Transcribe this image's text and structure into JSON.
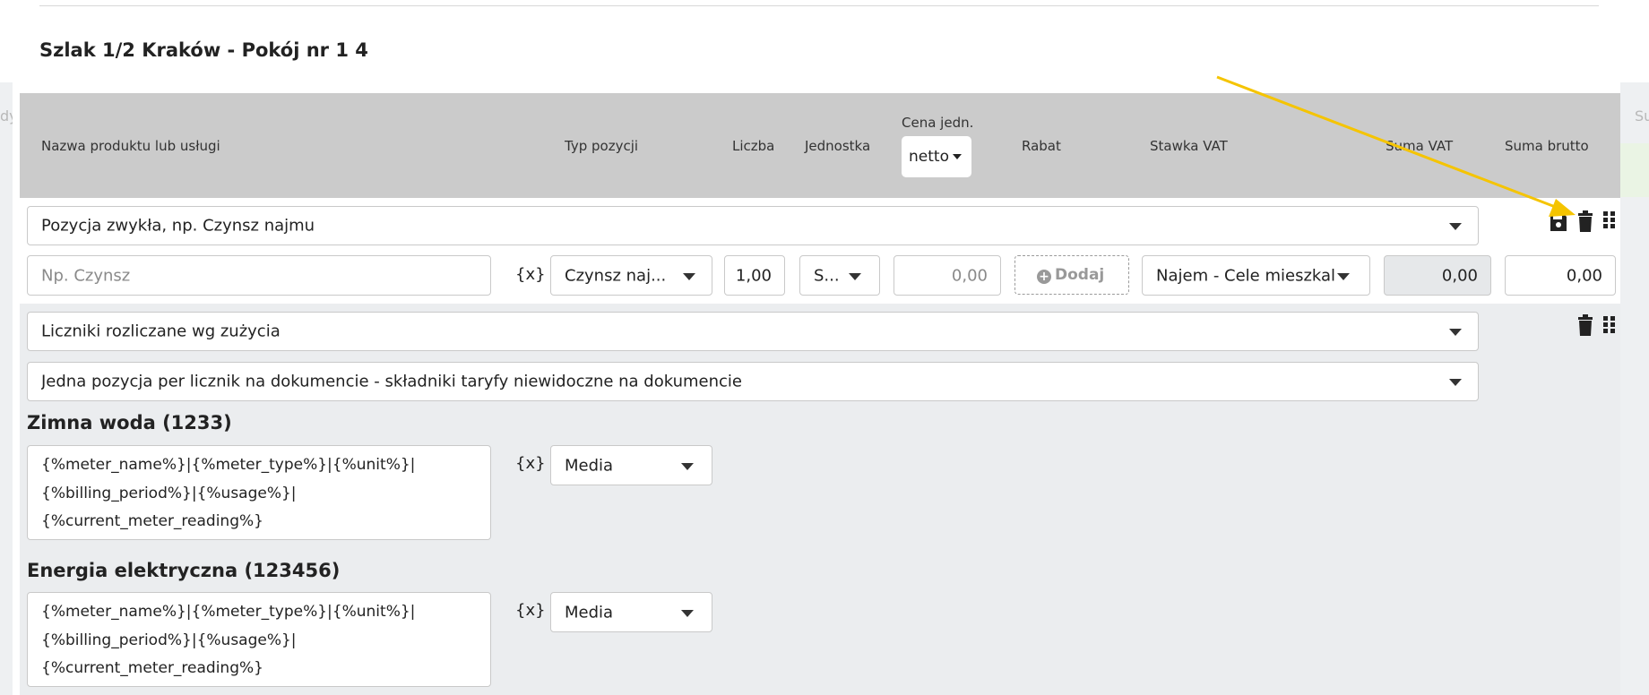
{
  "background": {
    "left_fragment": "dy",
    "right_fragment": "Su"
  },
  "title": "Szlak 1/2 Kraków - Pokój nr 1 4",
  "columns": {
    "name": "Nazwa produktu lub usługi",
    "type": "Typ pozycji",
    "qty": "Liczba",
    "unit": "Jednostka",
    "price": "Cena jedn.",
    "price_mode": "netto",
    "discount": "Rabat",
    "vat_rate": "Stawka VAT",
    "vat_sum": "Suma VAT",
    "gross_sum": "Suma brutto"
  },
  "row1": {
    "kind_select": "Pozycja zwykła, np. Czynsz najmu",
    "name_placeholder": "Np. Czynsz",
    "var_button": "{x}",
    "type_select": "Czynsz naj...",
    "qty": "1,00",
    "unit_select": "S...",
    "price_placeholder": "0,00",
    "discount_button": "Dodaj",
    "vat_select": "Najem - Cele mieszkal",
    "vat_sum": "0,00",
    "gross_sum": "0,00"
  },
  "row2": {
    "kind_select": "Liczniki rozliczane wg zużycia",
    "mode_select": "Jedna pozycja per licznik na dokumencie - składniki taryfy niewidoczne na dokumencie",
    "meters": [
      {
        "title": "Zimna woda (1233)",
        "template_lines": [
          "{%meter_name%}|{%meter_type%}|{%unit%}|",
          "{%billing_period%}|{%usage%}|",
          "{%current_meter_reading%}"
        ],
        "var_button": "{x}",
        "type_select": "Media"
      },
      {
        "title": "Energia elektryczna (123456)",
        "template_lines": [
          "{%meter_name%}|{%meter_type%}|{%unit%}|",
          "{%billing_period%}|{%usage%}|",
          "{%current_meter_reading%}"
        ],
        "var_button": "{x}",
        "type_select": "Media"
      }
    ]
  },
  "icons": [
    "save-icon",
    "trash-icon",
    "drag-handle-icon"
  ],
  "colors": {
    "header_bg": "#cbcbcb",
    "section_bg": "#ebedef",
    "arrow": "#f5c400"
  }
}
